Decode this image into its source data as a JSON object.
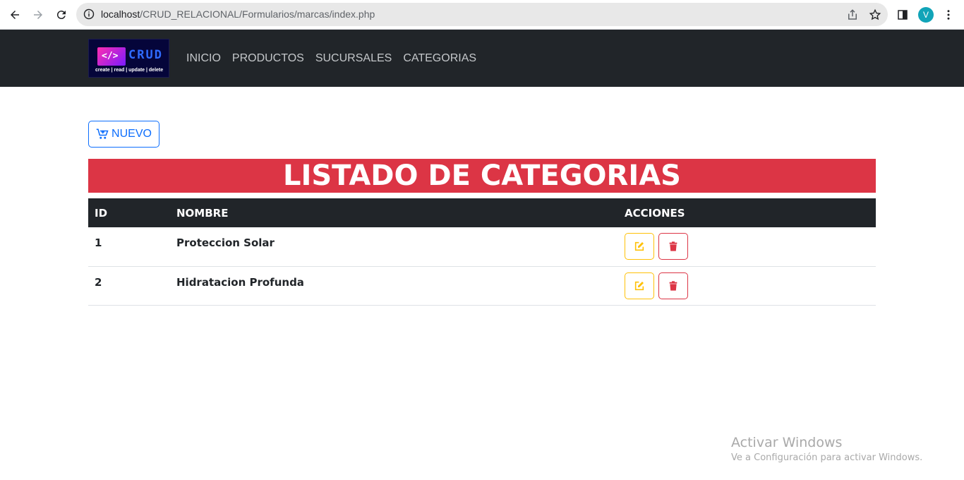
{
  "browser": {
    "url_host": "localhost",
    "url_path": "/CRUD_RELACIONAL/Formularios/marcas/index.php",
    "avatar_letter": "V"
  },
  "navbar": {
    "logo": {
      "code": "</>",
      "title": "CRUD",
      "tagline": "create | read | update | delete"
    },
    "links": [
      "INICIO",
      "PRODUCTOS",
      "SUCURSALES",
      "CATEGORIAS"
    ]
  },
  "toolbar": {
    "new_label": "NUEVO"
  },
  "page": {
    "title": "LISTADO DE CATEGORIAS"
  },
  "table": {
    "headers": {
      "id": "ID",
      "name": "NOMBRE",
      "actions": "ACCIONES"
    },
    "rows": [
      {
        "id": "1",
        "name": "Proteccion Solar"
      },
      {
        "id": "2",
        "name": "Hidratacion Profunda"
      }
    ]
  },
  "watermark": {
    "line1": "Activar Windows",
    "line2": "Ve a Configuración para activar Windows."
  },
  "colors": {
    "navbar": "#212529",
    "banner": "#dc3545",
    "primary": "#0d6efd",
    "warning": "#ffc107",
    "danger": "#dc3545"
  }
}
